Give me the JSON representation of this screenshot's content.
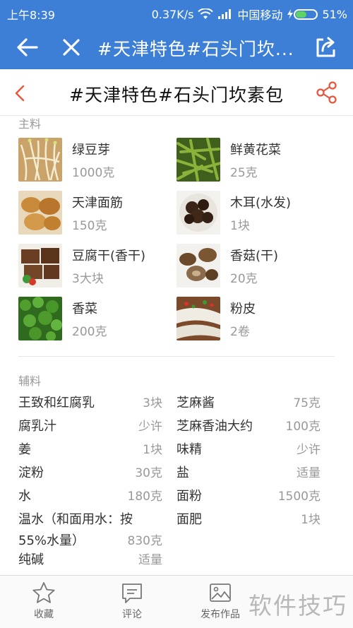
{
  "status_bar": {
    "time": "上午8:39",
    "network_speed": "0.37K/s",
    "carrier": "中国移动",
    "battery_percent": "51%",
    "battery_level": 0.51
  },
  "nav": {
    "title": "#天津特色#石头门坎..."
  },
  "page": {
    "title": "#天津特色#石头门坎素包"
  },
  "main_section": {
    "label": "主料",
    "items": [
      {
        "name": "绿豆芽",
        "qty": "1000克",
        "icon": "bean-sprouts-photo"
      },
      {
        "name": "鲜黄花菜",
        "qty": "25克",
        "icon": "daylily-photo"
      },
      {
        "name": "天津面筋",
        "qty": "150克",
        "icon": "gluten-photo"
      },
      {
        "name": "木耳(水发)",
        "qty": "1块",
        "icon": "wood-ear-photo"
      },
      {
        "name": "豆腐干(香干)",
        "qty": "3大块",
        "icon": "dried-tofu-photo"
      },
      {
        "name": "香菇(干)",
        "qty": "20克",
        "icon": "shiitake-photo"
      },
      {
        "name": "香菜",
        "qty": "200克",
        "icon": "cilantro-photo"
      },
      {
        "name": "粉皮",
        "qty": "2卷",
        "icon": "noodle-sheet-photo"
      }
    ]
  },
  "aux_section": {
    "label": "辅料",
    "items": [
      {
        "name": "王致和红腐乳",
        "qty": "3块"
      },
      {
        "name": "芝麻酱",
        "qty": "75克"
      },
      {
        "name": "腐乳汁",
        "qty": "少许"
      },
      {
        "name": "芝麻香油大约",
        "qty": "100克"
      },
      {
        "name": "姜",
        "qty": "1块"
      },
      {
        "name": "味精",
        "qty": "少许"
      },
      {
        "name": "淀粉",
        "qty": "30克"
      },
      {
        "name": "盐",
        "qty": "适量"
      },
      {
        "name": "水",
        "qty": "180克"
      },
      {
        "name": "面粉",
        "qty": "1500克"
      },
      {
        "name": "温水（和面用水：按55%水量）",
        "qty": "830克"
      },
      {
        "name": "面肥",
        "qty": "1块"
      },
      {
        "name": "纯碱",
        "qty": "适量"
      }
    ]
  },
  "bottom_bar": {
    "favorite": "收藏",
    "comment": "评论",
    "publish": "发布作品",
    "watermark": "软件技巧"
  },
  "colors": {
    "header_blue": "#3d7fd6",
    "accent_red": "#e4573d"
  }
}
